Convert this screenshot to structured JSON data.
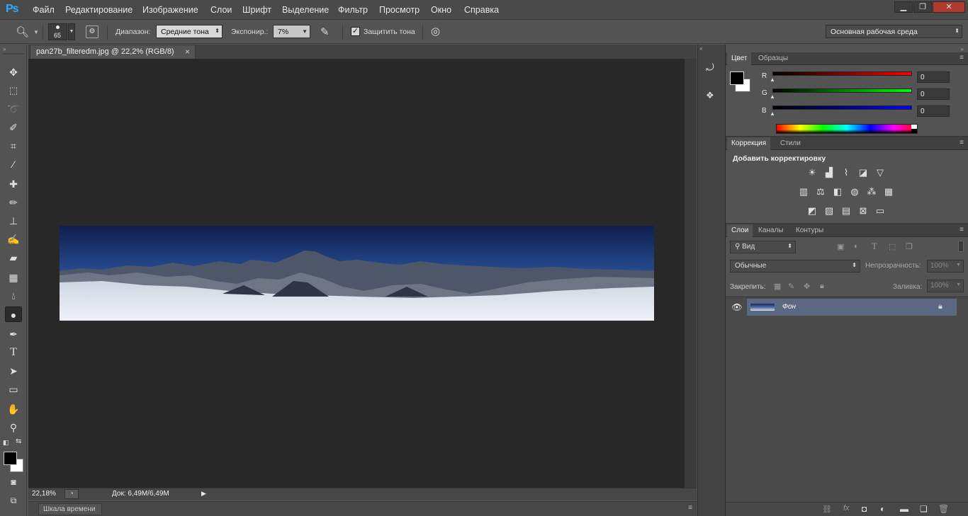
{
  "app": {
    "logo": "Ps"
  },
  "menubar": {
    "items": [
      "Файл",
      "Редактирование",
      "Изображение",
      "Слои",
      "Шрифт",
      "Выделение",
      "Фильтр",
      "Просмотр",
      "Окно",
      "Справка"
    ],
    "window_buttons": [
      "▁",
      "❐",
      "✕"
    ]
  },
  "options": {
    "brush_size": "65",
    "range_label": "Диапазон:",
    "range_value": "Средние тона",
    "exposure_label": "Экспонир.:",
    "exposure_value": "7%",
    "protect_tones_label": "Защитить тона",
    "protect_tones_checked": true,
    "workspace": "Основная рабочая среда"
  },
  "document": {
    "tab_title": "pan27b_filteredm.jpg @ 22,2% (RGB/8)",
    "tab_close": "×"
  },
  "status": {
    "zoom": "22,18%",
    "doc_info": "Док: 6,49М/6,49М"
  },
  "timeline": {
    "label": "Шкала времени"
  },
  "color_panel": {
    "tabs": [
      "Цвет",
      "Образцы"
    ],
    "channels": [
      {
        "name": "R",
        "value": "0",
        "color": "#e00000"
      },
      {
        "name": "G",
        "value": "0",
        "color": "#00c000"
      },
      {
        "name": "B",
        "value": "0",
        "color": "#0000e0"
      }
    ],
    "foreground": "#000000",
    "background": "#ffffff"
  },
  "adjustments_panel": {
    "tabs": [
      "Коррекция",
      "Стили"
    ],
    "heading": "Добавить корректировку",
    "icon_rows": [
      [
        "brightness-icon",
        "levels-icon",
        "curves-icon",
        "exposure-icon",
        "vibrance-icon"
      ],
      [
        "hue-saturation-icon",
        "color-balance-icon",
        "black-white-icon",
        "photo-filter-icon",
        "channel-mixer-icon",
        "color-lookup-icon"
      ],
      [
        "invert-icon",
        "posterize-icon",
        "threshold-icon",
        "selective-color-icon",
        "gradient-map-icon"
      ]
    ]
  },
  "layers_panel": {
    "tabs": [
      "Слои",
      "Каналы",
      "Контуры"
    ],
    "filter_kind": "Вид",
    "blend_mode": "Обычные",
    "opacity_label": "Непрозрачность:",
    "opacity_value": "100%",
    "lock_label": "Закрепить:",
    "fill_label": "Заливка:",
    "fill_value": "100%",
    "layers": [
      {
        "name": "Фон",
        "visible": true,
        "locked": true
      }
    ]
  }
}
